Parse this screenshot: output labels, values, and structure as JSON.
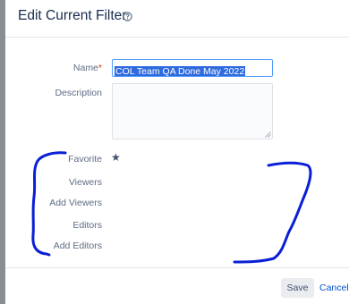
{
  "dialog": {
    "title": "Edit Current Filter",
    "help_icon": "help-circle-icon"
  },
  "form": {
    "name_label": "Name",
    "required_marker": "*",
    "name_value": "COL Team QA Done May 2022",
    "description_label": "Description",
    "description_value": "",
    "favorite_label": "Favorite",
    "favorite_icon": "star-icon",
    "viewers_label": "Viewers",
    "add_viewers_label": "Add Viewers",
    "editors_label": "Editors",
    "add_editors_label": "Add Editors"
  },
  "footer": {
    "save_label": "Save",
    "cancel_label": "Cancel"
  },
  "colors": {
    "annotation": "#0a1fd6",
    "link": "#0052cc",
    "selection": "#2f6bde",
    "required": "#de350b"
  }
}
